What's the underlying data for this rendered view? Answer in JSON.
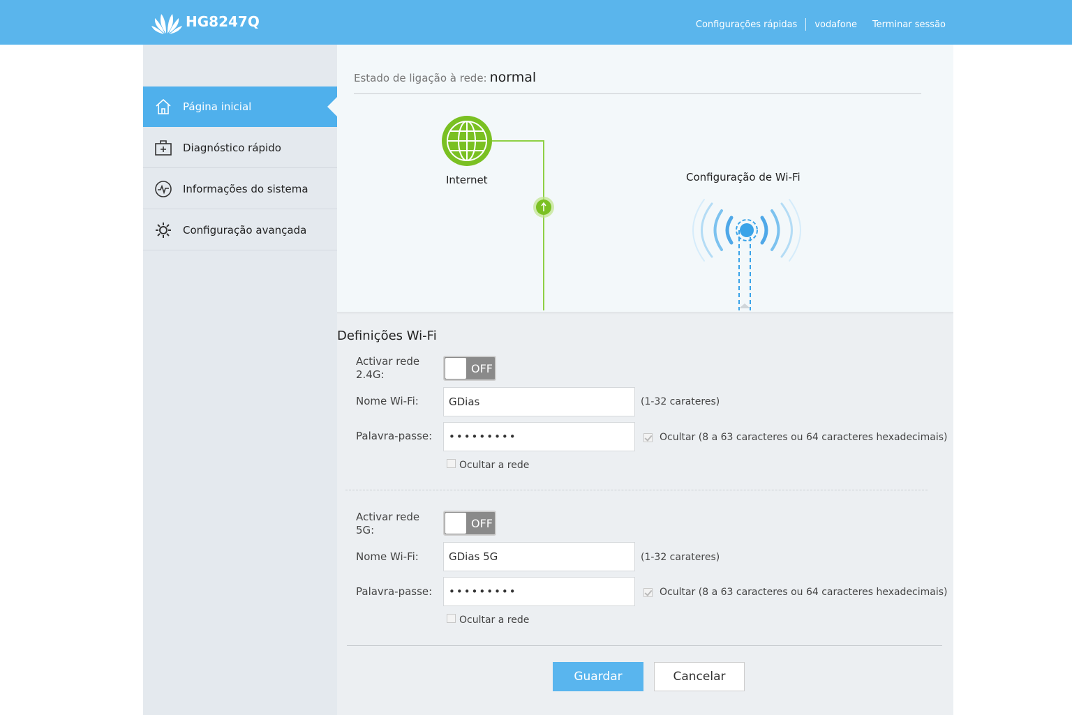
{
  "header": {
    "model": "HG8247Q",
    "nav": [
      "Configurações rápidas",
      "vodafone",
      "Terminar sessão"
    ]
  },
  "sidebar": {
    "items": [
      {
        "label": "Página inicial",
        "icon": "home-icon",
        "active": true
      },
      {
        "label": "Diagnóstico rápido",
        "icon": "first-aid-icon",
        "active": false
      },
      {
        "label": "Informações do sistema",
        "icon": "pulse-icon",
        "active": false
      },
      {
        "label": "Configuração avançada",
        "icon": "gear-icon",
        "active": false
      }
    ]
  },
  "topology": {
    "status_label": "Estado de ligação à rede:",
    "status_value": "normal",
    "internet_label": "Internet",
    "wifi_label": "Configuração de Wi-Fi"
  },
  "wifi": {
    "title": "Definições Wi-Fi",
    "band24": {
      "enable_label_1": "Activar rede",
      "enable_label_2": "2.4G:",
      "toggle_state": "OFF",
      "name_label": "Nome Wi-Fi:",
      "name_value": "GDias",
      "name_hint": "(1-32 carateres)",
      "password_label": "Palavra-passe:",
      "password_value": "•••••••••",
      "hide_password_label": "Ocultar (8 a 63 caracteres ou 64 caracteres hexadecimais)",
      "hide_network_label": "Ocultar a rede"
    },
    "band5": {
      "enable_label_1": "Activar rede",
      "enable_label_2": "5G:",
      "toggle_state": "OFF",
      "name_label": "Nome Wi-Fi:",
      "name_value": "GDias 5G",
      "name_hint": "(1-32 carateres)",
      "password_label": "Palavra-passe:",
      "password_value": "•••••••••",
      "hide_password_label": "Ocultar (8 a 63 caracteres ou 64 caracteres hexadecimais)",
      "hide_network_label": "Ocultar a rede"
    }
  },
  "actions": {
    "save": "Guardar",
    "cancel": "Cancelar"
  },
  "colors": {
    "header": "#5ab5ec",
    "active_item": "#4fb0ec",
    "internet_green": "#7ac022",
    "wifi_blue": "#3aa3e8"
  }
}
